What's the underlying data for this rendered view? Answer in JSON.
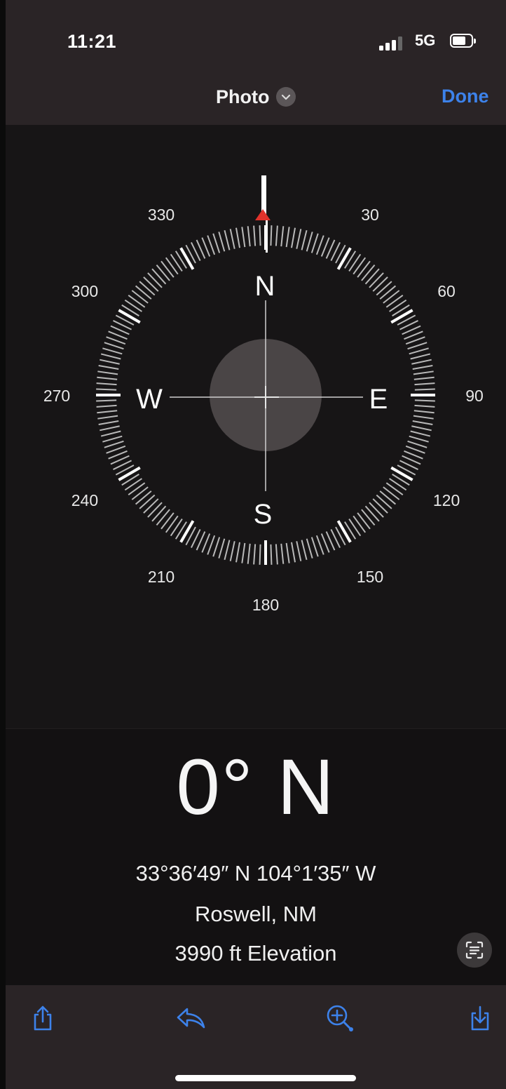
{
  "status_bar": {
    "time": "11:21",
    "network": "5G",
    "signal_bars": 4,
    "signal_bars_active": 3
  },
  "nav": {
    "title": "Photo",
    "done_label": "Done",
    "accent_color": "#3d82ea"
  },
  "compass": {
    "degree_labels": [
      "30",
      "60",
      "90",
      "120",
      "150",
      "180",
      "210",
      "240",
      "270",
      "300",
      "330"
    ],
    "cardinals": {
      "north": "N",
      "east": "E",
      "south": "S",
      "west": "W"
    },
    "heading_degrees": 0,
    "pointer_color": "#e0322b"
  },
  "reading": {
    "heading_value": "0°",
    "heading_dir": "N",
    "coordinates": "33°36′49″ N  104°1′35″ W",
    "city": "Roswell, NM",
    "elevation": "3990 ft Elevation"
  },
  "toolbar": {
    "share_icon": "share-icon",
    "reply_icon": "reply-icon",
    "zoom_icon": "zoom-in-icon",
    "save_icon": "save-download-icon",
    "livetext_icon": "live-text-icon"
  }
}
